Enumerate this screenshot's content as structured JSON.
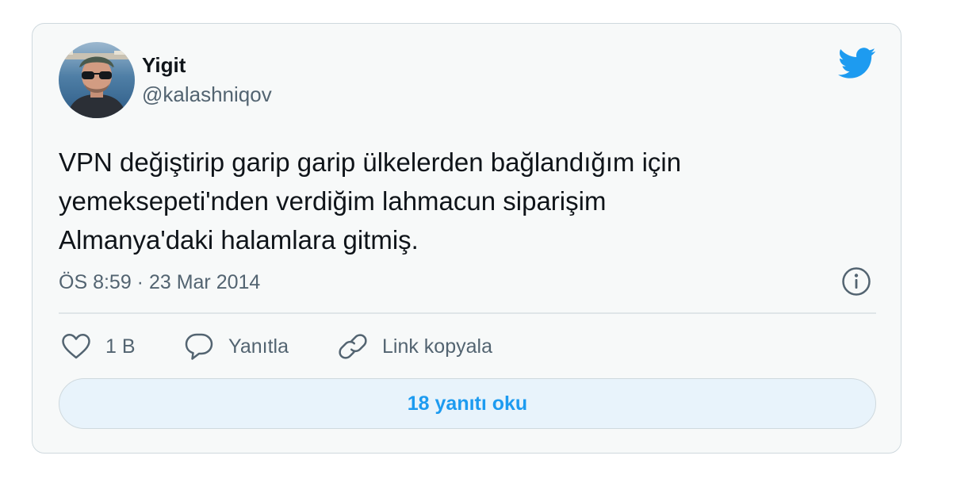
{
  "tweet": {
    "author_name": "Yigit",
    "author_handle": "@kalashniqov",
    "text": "VPN değiştirip garip garip ülkelerden bağlandığım için\nyemeksepeti'nden verdiğim lahmacun siparişim\nAlmanya'daki halamlara gitmiş.",
    "timestamp": "ÖS 8:59 · 23 Mar 2014"
  },
  "actions": {
    "like_count": "1 B",
    "reply_label": "Yanıtla",
    "copy_link_label": "Link kopyala"
  },
  "read_replies_label": "18 yanıtı oku",
  "icons": {
    "brand": "twitter-bird-icon",
    "info": "info-icon",
    "like": "heart-icon",
    "reply": "speech-bubble-icon",
    "copy": "link-icon"
  },
  "colors": {
    "accent": "#1d9bf0",
    "text_primary": "#0f1419",
    "text_secondary": "#536471",
    "card_background": "#f7f9f9",
    "card_border": "#cfd9de",
    "button_background": "#e8f3fb"
  }
}
